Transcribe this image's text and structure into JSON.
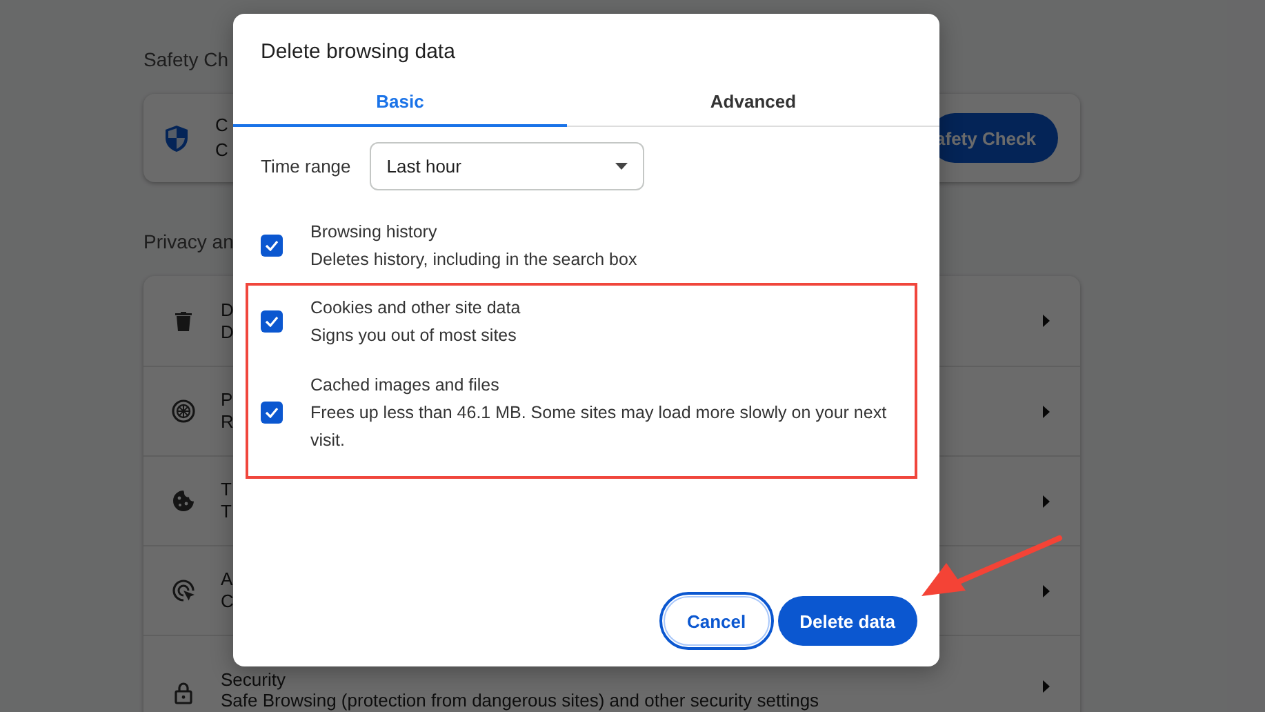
{
  "background": {
    "section_title": "Safety Ch",
    "safety_card": {
      "title": "C",
      "subtitle": "C",
      "button": "afety Check"
    },
    "privacy_title": "Privacy an",
    "rows": [
      {
        "title": "D",
        "subtitle": "D"
      },
      {
        "title": "P",
        "subtitle": "R"
      },
      {
        "title": "T",
        "subtitle": "T"
      },
      {
        "title": "A",
        "subtitle": "C"
      },
      {
        "title": "Security",
        "subtitle": "Safe Browsing (protection from dangerous sites) and other security settings"
      }
    ]
  },
  "dialog": {
    "title": "Delete browsing data",
    "tabs": [
      {
        "label": "Basic",
        "selected": true
      },
      {
        "label": "Advanced",
        "selected": false
      }
    ],
    "time_range": {
      "label": "Time range",
      "value": "Last hour"
    },
    "options": [
      {
        "title": "Browsing history",
        "description": "Deletes history, including in the search box",
        "checked": true,
        "highlighted": false
      },
      {
        "title": "Cookies and other site data",
        "description": "Signs you out of most sites",
        "checked": true,
        "highlighted": true
      },
      {
        "title": "Cached images and files",
        "description": "Frees up less than 46.1 MB. Some sites may load more slowly on your next visit.",
        "checked": true,
        "highlighted": true
      }
    ],
    "buttons": [
      {
        "label": "Cancel",
        "kind": "secondary",
        "focused": true
      },
      {
        "label": "Delete data",
        "kind": "primary",
        "focused": false
      }
    ]
  }
}
